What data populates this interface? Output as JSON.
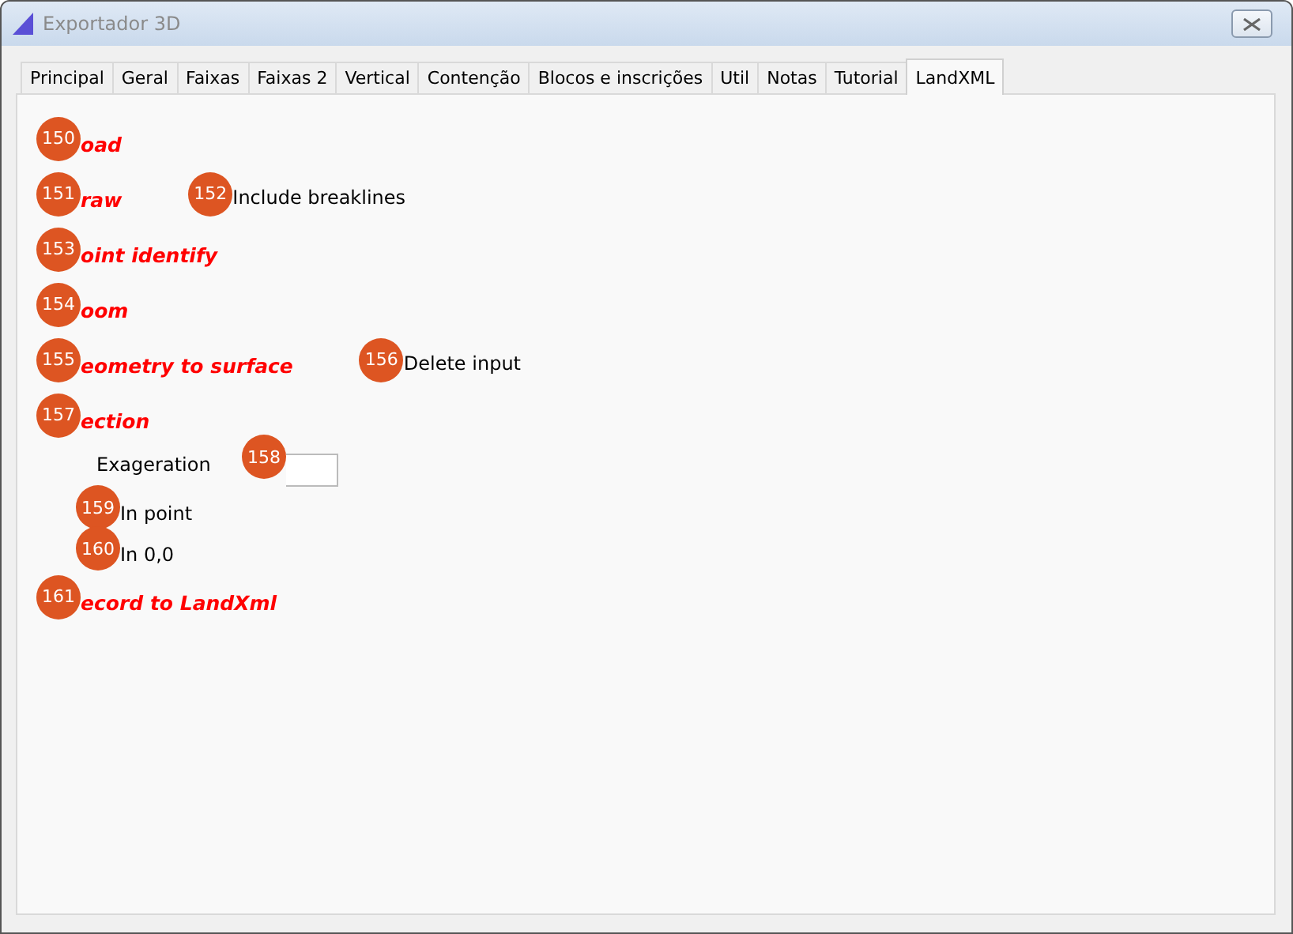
{
  "window": {
    "title": "Exportador 3D"
  },
  "tabs": [
    {
      "label": "Principal",
      "selected": false
    },
    {
      "label": "Geral",
      "selected": false
    },
    {
      "label": "Faixas",
      "selected": false
    },
    {
      "label": "Faixas 2",
      "selected": false
    },
    {
      "label": "Vertical",
      "selected": false
    },
    {
      "label": "Contenção",
      "selected": false
    },
    {
      "label": "Blocos e inscrições",
      "selected": false
    },
    {
      "label": "Util",
      "selected": false
    },
    {
      "label": "Notas",
      "selected": false
    },
    {
      "label": "Tutorial",
      "selected": false
    },
    {
      "label": "LandXML",
      "selected": true
    }
  ],
  "rows": [
    {
      "kind": "action",
      "badge": "150",
      "label": "oad"
    },
    {
      "kind": "action",
      "badge": "151",
      "label": "raw",
      "option": {
        "badge": "152",
        "label": "Include breaklines"
      }
    },
    {
      "kind": "action",
      "badge": "153",
      "label": "oint identify"
    },
    {
      "kind": "action",
      "badge": "154",
      "label": "oom"
    },
    {
      "kind": "action",
      "badge": "155",
      "label": "eometry to surface",
      "option": {
        "badge": "156",
        "label": "Delete input"
      }
    },
    {
      "kind": "action",
      "badge": "157",
      "label": "ection"
    },
    {
      "kind": "field",
      "label": "Exageration",
      "badge": "158"
    },
    {
      "kind": "radio",
      "badge": "159",
      "label": "In point"
    },
    {
      "kind": "radio",
      "badge": "160",
      "label": "In 0,0"
    },
    {
      "kind": "action",
      "badge": "161",
      "label": "ecord to LandXml"
    }
  ]
}
